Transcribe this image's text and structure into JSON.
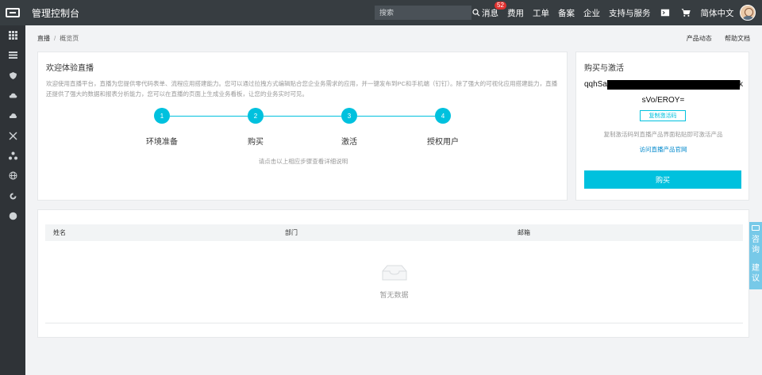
{
  "topbar": {
    "app_title": "管理控制台",
    "search_placeholder": "搜索",
    "nav": [
      "消息",
      "费用",
      "工单",
      "备案",
      "企业",
      "支持与服务"
    ],
    "messages_badge": "52",
    "language": "简体中文",
    "icons": [
      "logo-icon",
      "search-icon",
      "terminal-icon",
      "cart-icon",
      "avatar"
    ]
  },
  "sidebar": {
    "icons": [
      "grid-icon",
      "list-icon",
      "shield-icon",
      "cloud-icon",
      "cloud-icon",
      "shuffle-icon",
      "network-icon",
      "globe-icon",
      "refresh-icon",
      "circle-icon"
    ]
  },
  "breadcrumb": {
    "root": "直播",
    "sep": "/",
    "current": "概览页"
  },
  "top_links": {
    "product_news": "产品动态",
    "help_docs": "帮助文档"
  },
  "welcome": {
    "title": "欢迎体验直播",
    "desc": "欢迎使用直播平台，直播为您提供零代码表单、流程应用搭建能力。您可以通过拉拽方式编辑贴合您企业务需求的应用，并一键发布到PC和手机端（钉钉）。除了强大的可视化应用搭建能力，直播还提供了强大的数据和报表分析能力，您可以在直播的页面上生成业务看板，让您的业务实时可见。",
    "steps": [
      {
        "num": "1",
        "label": "环境准备"
      },
      {
        "num": "2",
        "label": "购买"
      },
      {
        "num": "3",
        "label": "激活"
      },
      {
        "num": "4",
        "label": "授权用户"
      }
    ],
    "hint": "请点击以上相应步骤查看详细说明",
    "accent": "#00c1de"
  },
  "buy": {
    "title": "购买与激活",
    "code_line1_start": "qqhSa",
    "code_line1_end": "k",
    "code_line2": "sVo/EROY=",
    "copy_button": "复制激活码",
    "copy_hint": "复制激活码到直播产品界面粘贴即可激活产品",
    "visit_link": "访问直播产品官网",
    "buy_button": "购买"
  },
  "table": {
    "columns": [
      "姓名",
      "部门",
      "邮箱"
    ],
    "empty_text": "暂无数据"
  },
  "float": {
    "text1": "咨询",
    "text2": "建议"
  }
}
